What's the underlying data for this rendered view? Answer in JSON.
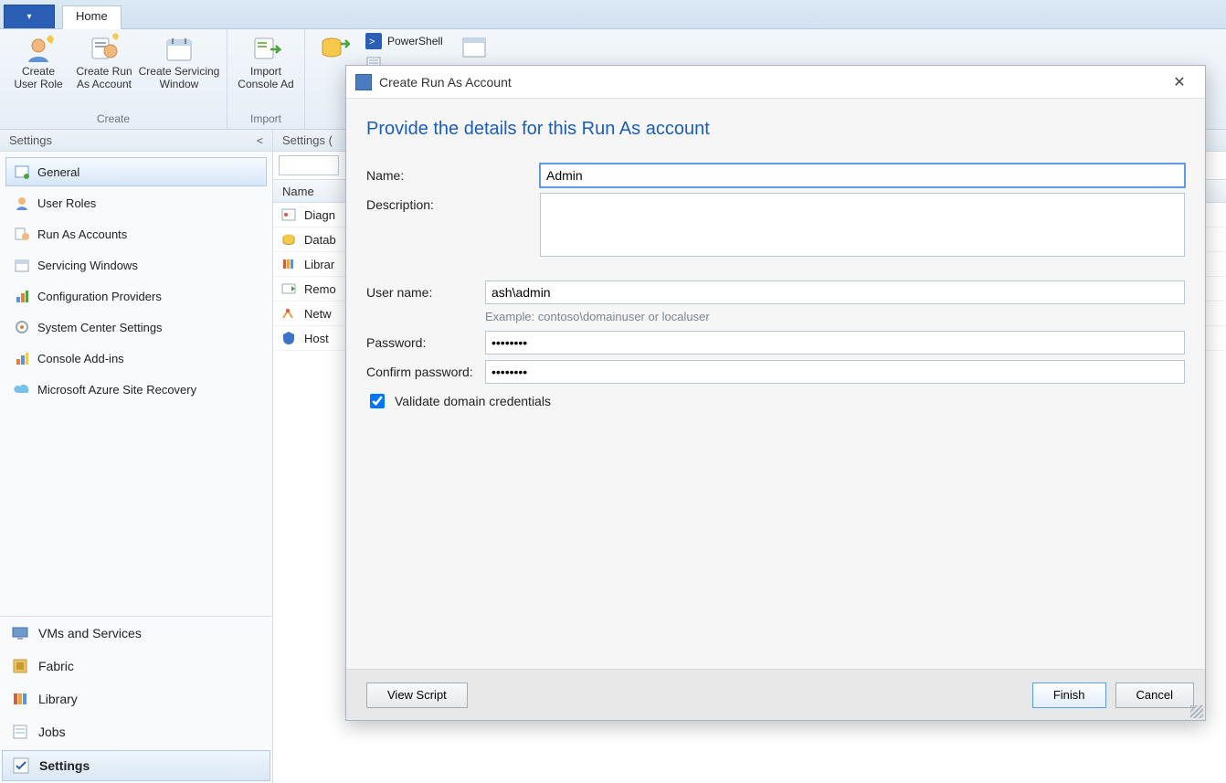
{
  "tabs": {
    "home": "Home"
  },
  "ribbon": {
    "create_user_role": "Create\nUser Role",
    "create_run_as": "Create Run\nAs Account",
    "create_servicing": "Create Servicing\nWindow",
    "import_console_addin": "Import\nConsole Ad",
    "powershell": "PowerShell",
    "group_create": "Create",
    "group_import": "Import"
  },
  "sidebar": {
    "title": "Settings",
    "items": [
      {
        "label": "General"
      },
      {
        "label": "User Roles"
      },
      {
        "label": "Run As Accounts"
      },
      {
        "label": "Servicing Windows"
      },
      {
        "label": "Configuration Providers"
      },
      {
        "label": "System Center Settings"
      },
      {
        "label": "Console Add-ins"
      },
      {
        "label": "Microsoft Azure Site Recovery"
      }
    ],
    "wunderbar": [
      {
        "label": "VMs and Services"
      },
      {
        "label": "Fabric"
      },
      {
        "label": "Library"
      },
      {
        "label": "Jobs"
      },
      {
        "label": "Settings"
      }
    ]
  },
  "center": {
    "title": "Settings (",
    "column": "Name",
    "rows": [
      {
        "label": "Diagn"
      },
      {
        "label": "Datab"
      },
      {
        "label": "Librar"
      },
      {
        "label": "Remo"
      },
      {
        "label": "Netw"
      },
      {
        "label": "Host "
      }
    ]
  },
  "dialog": {
    "title": "Create Run As Account",
    "heading": "Provide the details for this Run As account",
    "labels": {
      "name": "Name:",
      "description": "Description:",
      "username": "User name:",
      "password": "Password:",
      "confirm": "Confirm password:"
    },
    "values": {
      "name": "Admin",
      "description": "",
      "username": "ash\\admin",
      "password": "••••••••",
      "confirm": "••••••••"
    },
    "username_hint": "Example: contoso\\domainuser or localuser",
    "validate_label": "Validate domain credentials",
    "validate_checked": true,
    "buttons": {
      "view_script": "View Script",
      "finish": "Finish",
      "cancel": "Cancel"
    }
  }
}
